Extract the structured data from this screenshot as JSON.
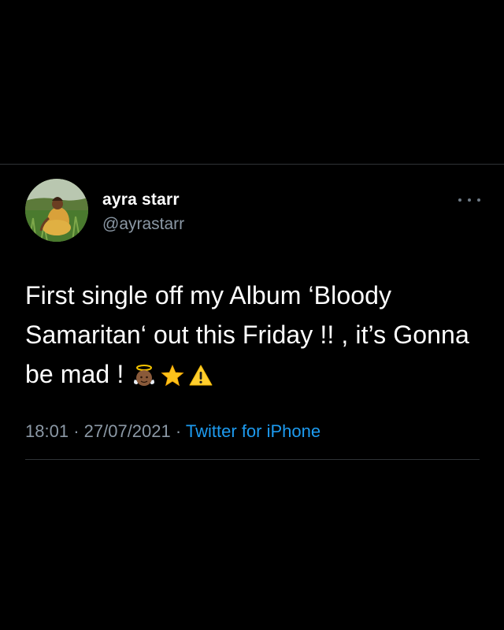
{
  "tweet": {
    "author": {
      "display_name": "ayra starr",
      "handle": "@ayrastarr",
      "avatar_icon": "profile-photo"
    },
    "more_icon": "more-options-icon",
    "text": "First single off my Album ‘Bloody Samaritan‘ out this Friday !! , it’s Gonna be mad !",
    "emojis": [
      "baby-angel-icon",
      "star-icon",
      "warning-icon"
    ],
    "time": "18:01",
    "separator": "·",
    "date": "27/07/2021",
    "source": "Twitter for iPhone"
  },
  "colors": {
    "background": "#000000",
    "text": "#ffffff",
    "secondary_text": "#8b98a5",
    "link": "#1d9bf0",
    "divider": "#2f3336"
  }
}
